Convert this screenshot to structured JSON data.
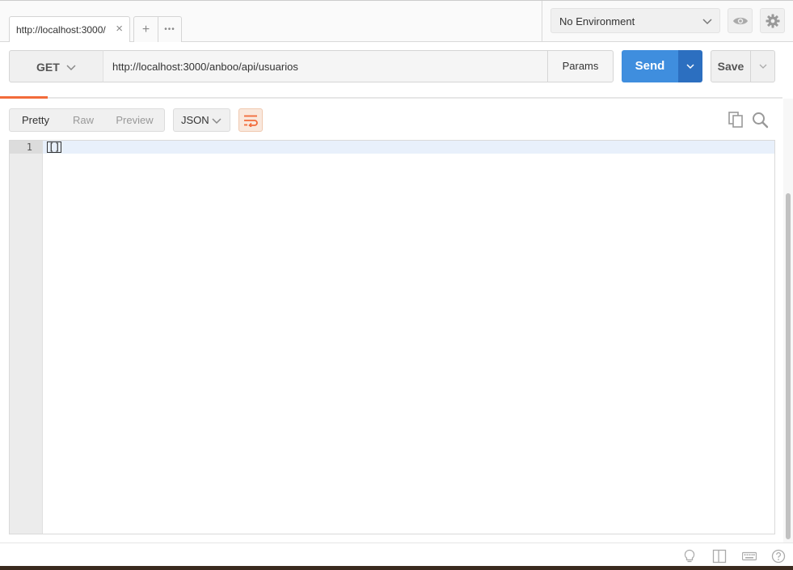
{
  "tab": {
    "title": "http://localhost:3000/",
    "close_icon": "close-icon"
  },
  "tab_actions": {
    "add": "+",
    "more": "•••"
  },
  "environment": {
    "selected": "No Environment"
  },
  "request": {
    "method": "GET",
    "url": "http://localhost:3000/anboo/api/usuarios",
    "params_label": "Params",
    "send_label": "Send",
    "save_label": "Save"
  },
  "response": {
    "views": [
      "Pretty",
      "Raw",
      "Preview"
    ],
    "active_view": "Pretty",
    "format": "JSON",
    "lines": [
      {
        "number": "1",
        "content": "[]"
      }
    ]
  },
  "colors": {
    "accent": "#f26b3a",
    "send": "#3f8ede",
    "send_dropdown": "#2c6fc0"
  },
  "icons": [
    "close-icon",
    "plus-icon",
    "more-icon",
    "chevron-down-icon",
    "eye-icon",
    "gear-icon",
    "wrap-icon",
    "copy-icon",
    "search-icon",
    "lightbulb-icon",
    "two-pane-icon",
    "keyboard-icon",
    "help-icon"
  ]
}
